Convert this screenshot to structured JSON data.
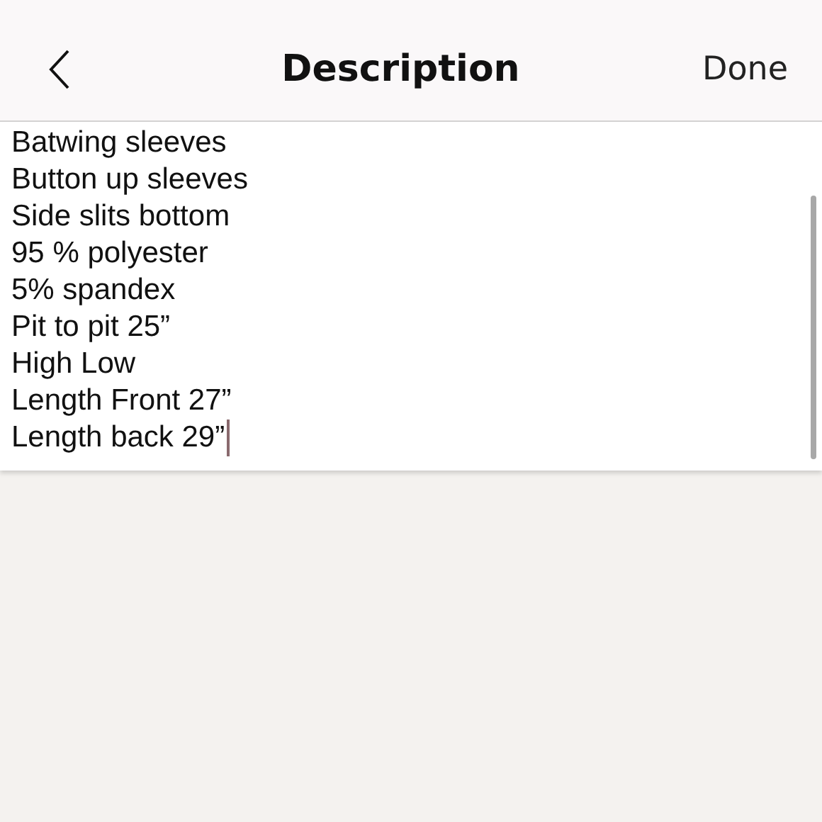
{
  "header": {
    "title": "Description",
    "done_label": "Done"
  },
  "editor": {
    "focused": true,
    "lines": [
      "Batwing sleeves",
      "Button up sleeves",
      "Side slits bottom",
      "95 % polyester",
      "5% spandex",
      "Pit to pit 25”",
      "High Low",
      "Length Front 27”",
      "Length back 29”"
    ]
  }
}
